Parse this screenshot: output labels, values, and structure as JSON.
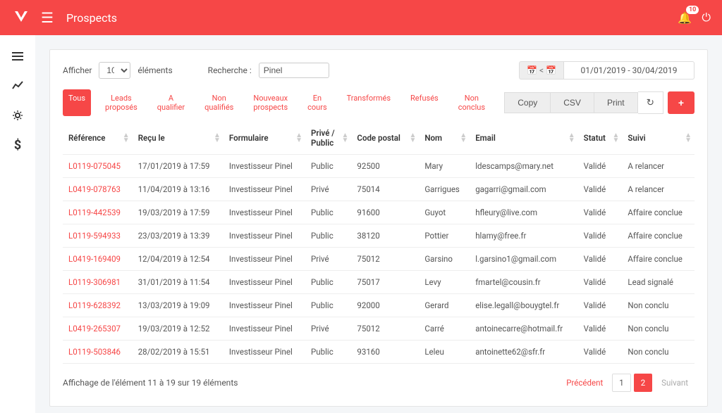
{
  "header": {
    "title": "Prospects",
    "notification_count": "10"
  },
  "filters": {
    "show_label": "Afficher",
    "page_size": "10",
    "elements_label": "éléments",
    "search_label": "Recherche :",
    "search_value": "Pinel",
    "date_range": "01/01/2019 - 30/04/2019"
  },
  "tabs": [
    "Tous",
    "Leads\nproposés",
    "A\nqualifier",
    "Non\nqualifiés",
    "Nouveaux\nprospects",
    "En\ncours",
    "Transformés",
    "Refusés",
    "Non\nconclus"
  ],
  "export": {
    "copy": "Copy",
    "csv": "CSV",
    "print": "Print"
  },
  "columns": [
    "Référence",
    "Reçu le",
    "Formulaire",
    "Privé / Public",
    "Code postal",
    "Nom",
    "Email",
    "Statut",
    "Suivi"
  ],
  "rows": [
    {
      "ref": "L0119-075045",
      "recu": "17/01/2019 à 17:59",
      "form": "Investisseur Pinel",
      "priv": "Public",
      "cp": "92500",
      "nom": "Mary",
      "email": "ldescamps@mary.net",
      "statut": "Validé",
      "suivi": "A relancer"
    },
    {
      "ref": "L0419-078763",
      "recu": "11/04/2019 à 13:16",
      "form": "Investisseur Pinel",
      "priv": "Privé",
      "cp": "75014",
      "nom": "Garrigues",
      "email": "gagarri@gmail.com",
      "statut": "Validé",
      "suivi": "A relancer"
    },
    {
      "ref": "L0119-442539",
      "recu": "19/03/2019 à 17:59",
      "form": "Investisseur Pinel",
      "priv": "Public",
      "cp": "91600",
      "nom": "Guyot",
      "email": "hfleury@live.com",
      "statut": "Validé",
      "suivi": "Affaire conclue"
    },
    {
      "ref": "L0119-594933",
      "recu": "23/03/2019 à 13:39",
      "form": "Investisseur Pinel",
      "priv": "Public",
      "cp": "38120",
      "nom": "Pottier",
      "email": "hlamy@free.fr",
      "statut": "Validé",
      "suivi": "Affaire conclue"
    },
    {
      "ref": "L0419-169409",
      "recu": "12/04/2019 à 12:54",
      "form": "Investisseur Pinel",
      "priv": "Privé",
      "cp": "75012",
      "nom": "Garsino",
      "email": "l.garsino1@gmail.com",
      "statut": "Validé",
      "suivi": "Affaire conclue"
    },
    {
      "ref": "L0119-306981",
      "recu": "31/01/2019 à 11:54",
      "form": "Investisseur Pinel",
      "priv": "Public",
      "cp": "75017",
      "nom": "Levy",
      "email": "fmartel@cousin.fr",
      "statut": "Validé",
      "suivi": "Lead signalé"
    },
    {
      "ref": "L0119-628392",
      "recu": "13/03/2019 à 19:09",
      "form": "Investisseur Pinel",
      "priv": "Public",
      "cp": "92000",
      "nom": "Gerard",
      "email": "elise.legall@bouygtel.fr",
      "statut": "Validé",
      "suivi": "Non conclu"
    },
    {
      "ref": "L0419-265307",
      "recu": "19/03/2019 à 12:52",
      "form": "Investisseur Pinel",
      "priv": "Privé",
      "cp": "75012",
      "nom": "Carré",
      "email": "antoinecarre@hotmail.fr",
      "statut": "Validé",
      "suivi": "Non conclu"
    },
    {
      "ref": "L0119-503846",
      "recu": "28/02/2019 à 15:51",
      "form": "Investisseur Pinel",
      "priv": "Public",
      "cp": "93160",
      "nom": "Leleu",
      "email": "antoinette62@sfr.fr",
      "statut": "Validé",
      "suivi": "Non conclu"
    }
  ],
  "footer": {
    "info": "Affichage de l'élément 11 à 19 sur 19 éléments",
    "prev": "Précédent",
    "p1": "1",
    "p2": "2",
    "next": "Suivant"
  }
}
